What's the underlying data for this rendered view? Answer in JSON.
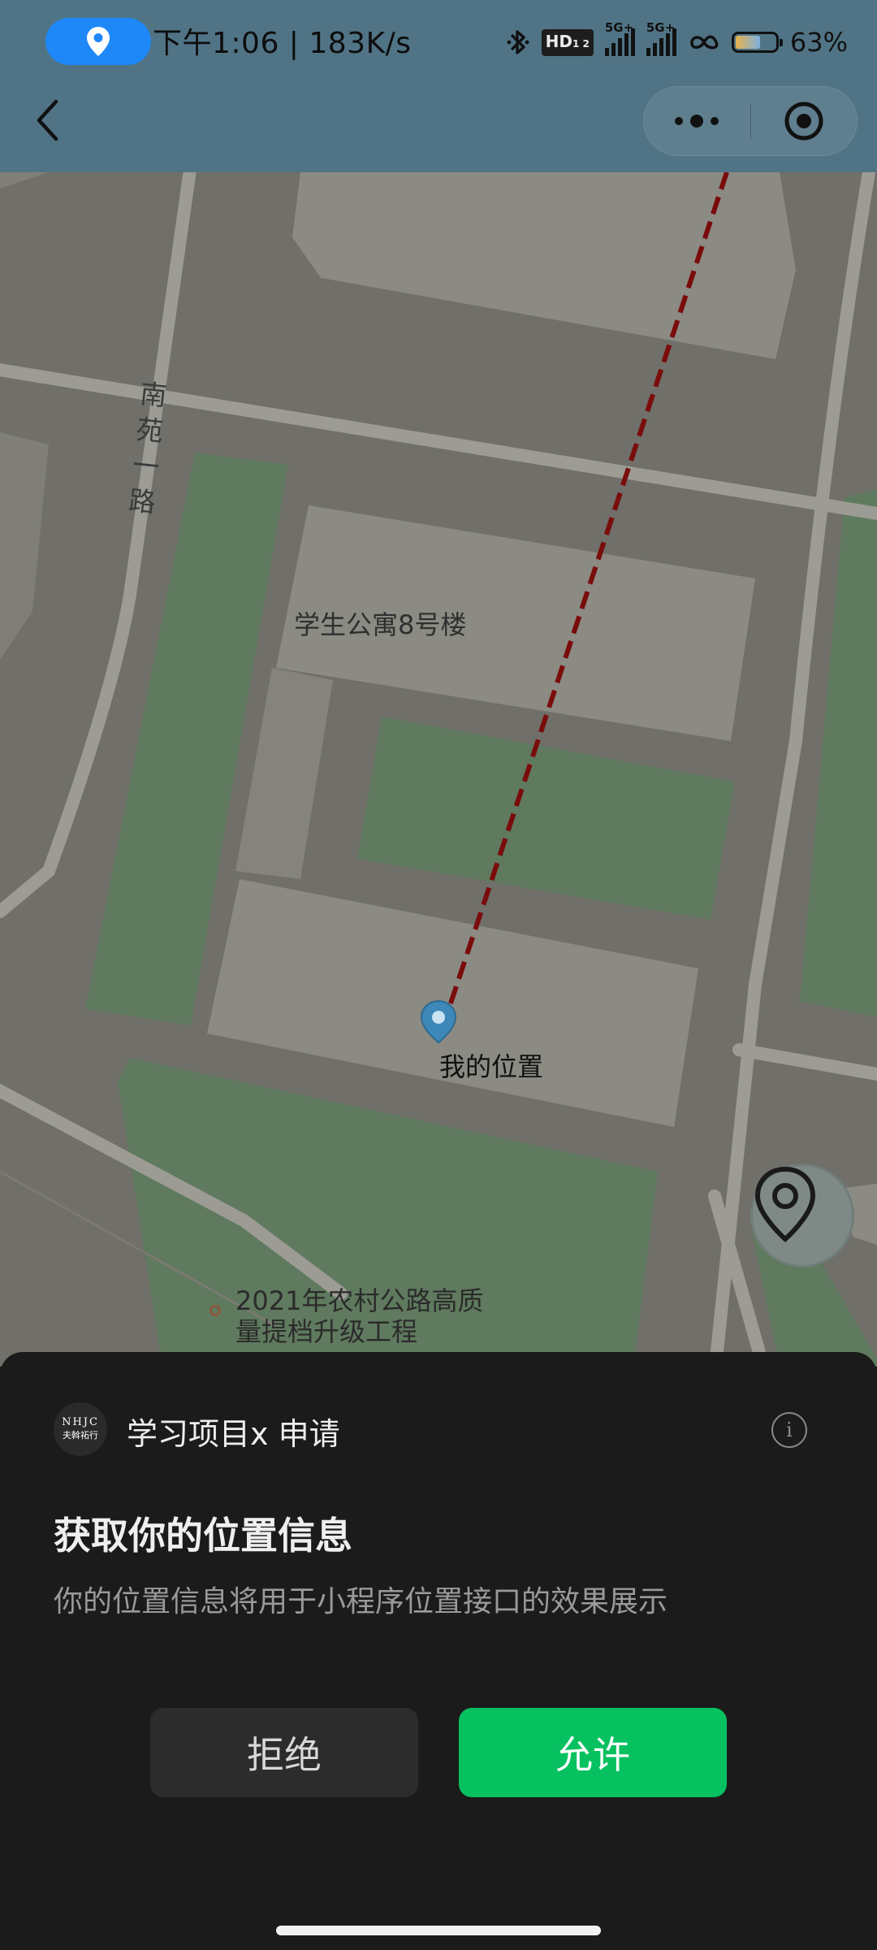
{
  "status_bar": {
    "time_and_speed": "下午1:06 | 183K/s",
    "hd_label": "HD",
    "hd_sub": "1 2",
    "signal1_label": "5G+",
    "signal2_label": "5G+",
    "battery_level": 63,
    "battery_text": "63%"
  },
  "map": {
    "road_name": "南苑一路",
    "building_label": "学生公寓8号楼",
    "my_location_label": "我的位置",
    "poi_label": "2021年农村公路高质量提档升级工程",
    "route_color": "#7a0c0c",
    "green_color": "#5f7a5e"
  },
  "sheet": {
    "avatar_line1": "NHJC",
    "avatar_line2": "夫斡祏行",
    "app_name": "学习项目x  申请",
    "title": "获取你的位置信息",
    "description": "你的位置信息将用于小程序位置接口的效果展示",
    "deny_label": "拒绝",
    "allow_label": "允许",
    "allow_color": "#07c160",
    "info_icon_char": "i"
  }
}
